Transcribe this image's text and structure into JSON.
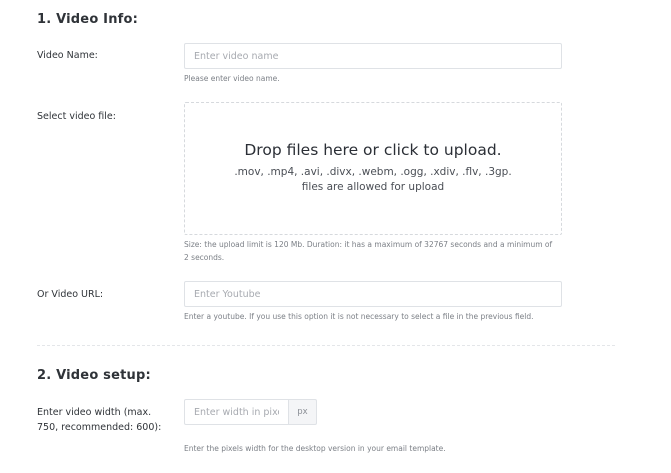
{
  "sections": {
    "video_info": {
      "title": "1. Video Info:"
    },
    "video_setup": {
      "title": "2. Video setup:"
    }
  },
  "video_name": {
    "label": "Video Name:",
    "placeholder": "Enter video name",
    "value": "",
    "help": "Please enter video name."
  },
  "video_file": {
    "label": "Select video file:",
    "drop_title": "Drop files here or click to upload.",
    "drop_formats": ".mov, .mp4, .avi, .divx, .webm, .ogg, .xdiv, .flv, .3gp.",
    "drop_allowed": "files are allowed for upload",
    "help": "Size: the upload limit is 120 Mb. Duration: it has a maximum of 32767 seconds and a minimum of 2 seconds."
  },
  "video_url": {
    "label": "Or Video URL:",
    "placeholder": "Enter Youtube",
    "value": "",
    "help": "Enter a youtube. If you use this option it is not necessary to select a file in the previous field."
  },
  "video_width": {
    "label": "Enter video width (max. 750, recommended: 600):",
    "placeholder": "Enter width in pixels",
    "value": "",
    "unit": "px",
    "help": "Enter the pixels width for the desktop version in your email template."
  }
}
